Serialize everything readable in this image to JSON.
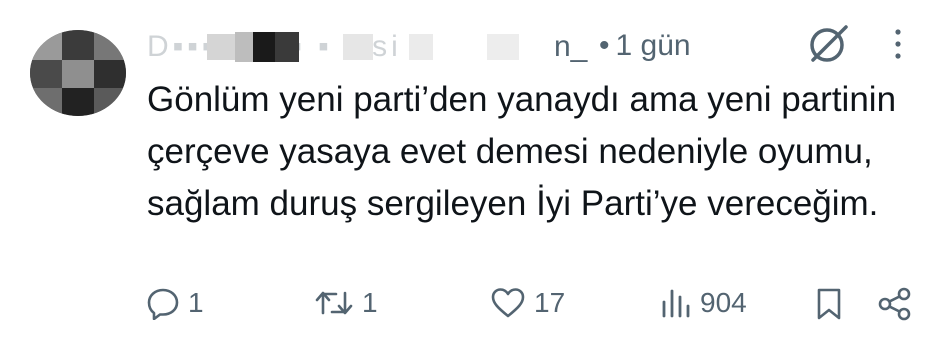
{
  "tweet": {
    "author_name": "D▪▪▪▪ et▪▪ ▪ ▪ si",
    "handle_tail": "n_",
    "separator": "•",
    "time": "1 gün",
    "text": "Gönlüm yeni parti’den yanaydı ama yeni partinin çerçeve yasaya evet demesi nedeniyle oyumu, sağlam duruş sergileyen İyi Parti’ye vereceğim."
  },
  "actions": {
    "reply_count": "1",
    "retweet_count": "1",
    "like_count": "17",
    "view_count": "904"
  },
  "icons": {
    "grok": "grok-icon",
    "more": "more-dots-icon",
    "reply": "reply-icon",
    "retweet": "retweet-icon",
    "like": "heart-icon",
    "views": "views-icon",
    "bookmark": "bookmark-icon",
    "share": "share-icon"
  },
  "colors": {
    "text": "#0f1419",
    "secondary": "#536471"
  }
}
